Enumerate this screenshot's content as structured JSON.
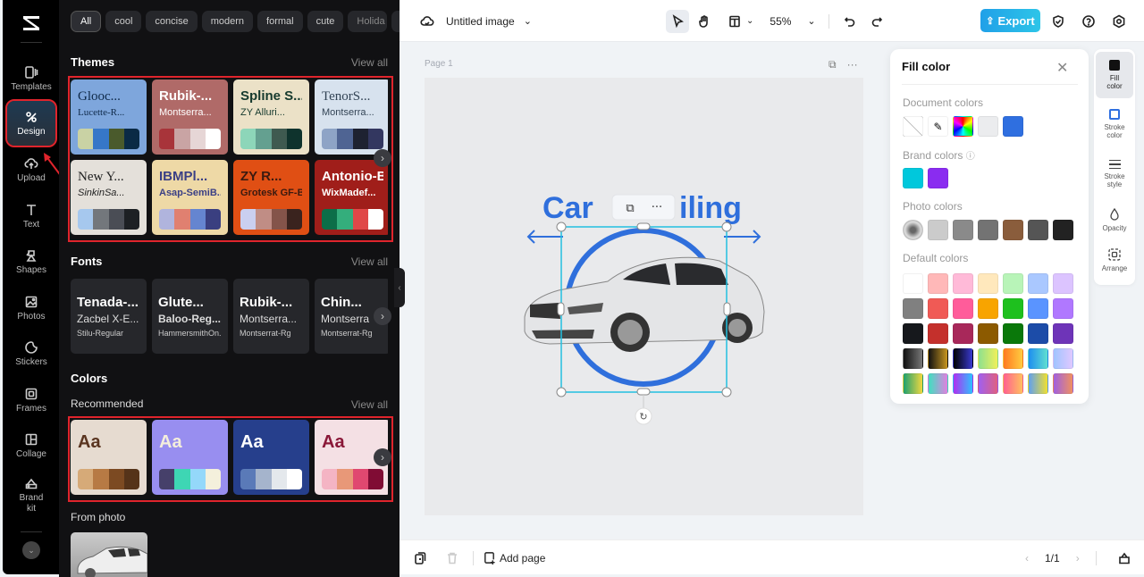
{
  "rail": {
    "items": [
      {
        "label": "Templates",
        "icon": "templates-icon"
      },
      {
        "label": "Design",
        "icon": "design-icon",
        "active": true
      },
      {
        "label": "Upload",
        "icon": "upload-icon"
      },
      {
        "label": "Text",
        "icon": "text-icon"
      },
      {
        "label": "Shapes",
        "icon": "shapes-icon"
      },
      {
        "label": "Photos",
        "icon": "photos-icon"
      },
      {
        "label": "Stickers",
        "icon": "stickers-icon"
      },
      {
        "label": "Frames",
        "icon": "frames-icon"
      },
      {
        "label": "Collage",
        "icon": "collage-icon"
      },
      {
        "label": "Brand kit",
        "icon": "brand-kit-icon"
      }
    ],
    "more_label": "⌄"
  },
  "panel": {
    "chips": [
      "All",
      "cool",
      "concise",
      "modern",
      "formal",
      "cute",
      "Holida"
    ],
    "themes": {
      "title": "Themes",
      "view_all": "View all",
      "cards": [
        {
          "t1": "Glooc...",
          "t2": "Lucette-R...",
          "bg": "#7ea6dc",
          "fg": "#0f2a4a",
          "colors": [
            "#c9d2a4",
            "#3677c8",
            "#4a5a2c",
            "#0a2a45"
          ]
        },
        {
          "t1": "Rubik-...",
          "t2": "Montserra...",
          "bg": "#b06a68",
          "fg": "#ffffff",
          "colors": [
            "#a8343a",
            "#c9a4a4",
            "#e6d6d6",
            "#ffffff"
          ]
        },
        {
          "t1": "Spline S...",
          "t2": "ZY Alluri...",
          "bg": "#ebe1c7",
          "fg": "#163a2e",
          "colors": [
            "#8dd6b9",
            "#64a090",
            "#3f5a50",
            "#0f332d"
          ]
        },
        {
          "t1": "TenorS...",
          "t2": "Montserra...",
          "bg": "#d7e2ee",
          "fg": "#334455",
          "colors": [
            "#8ea4c6",
            "#4f6493",
            "#1e2231",
            "#333760"
          ]
        },
        {
          "t1": "New Y...",
          "t2": "SinkinSa...",
          "bg": "#e4e0da",
          "fg": "#222222",
          "colors": [
            "#a6c8ee",
            "#73777c",
            "#4a4d55",
            "#1d2024"
          ]
        },
        {
          "t1": "IBMPl...",
          "t2": "Asap-SemiB...",
          "bg": "#eed9a6",
          "fg": "#3a3f85",
          "colors": [
            "#b0b4dd",
            "#e08070",
            "#6585d0",
            "#3a3f80"
          ]
        },
        {
          "t1": "ZY R...",
          "t2": "Grotesk GF-B...",
          "bg": "#e04f14",
          "fg": "#3a1a10",
          "colors": [
            "#cacff0",
            "#c08d85",
            "#84544a",
            "#3a231e"
          ]
        },
        {
          "t1": "Antonio-Bold",
          "t2": "WixMadef...",
          "bg": "#a01e1a",
          "fg": "#ffffff",
          "colors": [
            "#0c6e48",
            "#34ae7c",
            "#e04848",
            "#ffffff"
          ]
        }
      ]
    },
    "fonts": {
      "title": "Fonts",
      "view_all": "View all",
      "cards": [
        {
          "f1": "Tenada-...",
          "f2": "Zacbel X-E...",
          "f3": "Stilu-Regular"
        },
        {
          "f1": "Glute...",
          "f2": "Baloo-Reg...",
          "f3": "HammersmithOn..."
        },
        {
          "f1": "Rubik-...",
          "f2": "Montserra...",
          "f3": "Montserrat-Rg"
        },
        {
          "f1": "Chin...",
          "f2": "Montserra",
          "f3": "Montserrat-Rg"
        }
      ]
    },
    "colors": {
      "title": "Colors",
      "recommended": "Recommended",
      "view_all": "View all",
      "cards": [
        {
          "label": "Aa",
          "bg": "#e6dbd0",
          "fg": "#5a3520",
          "colors": [
            "#d6aa78",
            "#b77a44",
            "#7c4a22",
            "#553319"
          ]
        },
        {
          "label": "Aa",
          "bg": "#988ef0",
          "fg": "#f4eedc",
          "colors": [
            "#46406a",
            "#3ed6b4",
            "#94d8fa",
            "#f4f0dc"
          ]
        },
        {
          "label": "Aa",
          "bg": "#263f8c",
          "fg": "#ffffff",
          "colors": [
            "#5a7ab8",
            "#a5b4cc",
            "#e4e8ec",
            "#ffffff"
          ]
        },
        {
          "label": "Aa",
          "bg": "#f4e0e4",
          "fg": "#8a1838",
          "colors": [
            "#f4b4c4",
            "#e89878",
            "#e04870",
            "#800c34"
          ]
        }
      ],
      "from_photo": "From photo"
    }
  },
  "topbar": {
    "title": "Untitled image",
    "zoom": "55%",
    "export_label": "Export"
  },
  "canvas": {
    "page_label": "Page 1",
    "headline": "Car Detailing",
    "headline_visible_left": "Car ",
    "headline_visible_right": "iling",
    "headline_color": "#2f6fdc"
  },
  "bottombar": {
    "add_page": "Add page",
    "pagination": "1/1"
  },
  "fill_panel": {
    "title": "Fill color",
    "document_label": "Document colors",
    "document_colors": [
      "#ebecee",
      "#2f6fe0"
    ],
    "brand_label": "Brand colors",
    "brand_colors": [
      "#00c8dc",
      "#8a2cf0"
    ],
    "photo_label": "Photo colors",
    "photo_colors": [
      "#cbcbcb",
      "#8a8a8a",
      "#737373",
      "#8a5d3c",
      "#555555",
      "#222222"
    ],
    "default_label": "Default colors",
    "default_colors": [
      "#ffffff",
      "#ffb8b8",
      "#ffbad8",
      "#ffe8bc",
      "#b8f4b8",
      "#aac8ff",
      "#dcc4ff",
      "#808080",
      "#f05a55",
      "#ff5c9a",
      "#f8a400",
      "#1ec01e",
      "#5a94ff",
      "#b078ff",
      "#16181c",
      "#c4302c",
      "#a8285a",
      "#8c5a00",
      "#0a780a",
      "#1c4ca8",
      "#6e34b8",
      "linear-gradient(90deg,#111,#777)",
      "linear-gradient(90deg,#111,#c89620)",
      "linear-gradient(90deg,#000,#3a3ad0)",
      "linear-gradient(90deg,#8ee08e,#f0f05a)",
      "linear-gradient(90deg,#ff7a20,#ffcc40)",
      "linear-gradient(90deg,#1e8ef0,#60e0d0)",
      "linear-gradient(90deg,#a0c4ff,#e0c8ff)",
      "linear-gradient(90deg,#1ea070,#f0d840)",
      "linear-gradient(90deg,#40e0c0,#e080e0)",
      "linear-gradient(90deg,#b030f0,#30c0ff)",
      "linear-gradient(90deg,#a060f0,#e06080)",
      "linear-gradient(90deg,#ff6090,#ffc060)",
      "linear-gradient(90deg,#60a0f0,#f0e030)",
      "linear-gradient(90deg,#a060e0,#f09060)"
    ]
  },
  "props": [
    {
      "label": "Fill color",
      "icon": "fill-color-icon",
      "selected": true
    },
    {
      "label": "Stroke color",
      "icon": "stroke-color-icon"
    },
    {
      "label": "Stroke style",
      "icon": "stroke-style-icon"
    },
    {
      "label": "Opacity",
      "icon": "opacity-icon"
    },
    {
      "label": "Arrange",
      "icon": "arrange-icon"
    }
  ]
}
